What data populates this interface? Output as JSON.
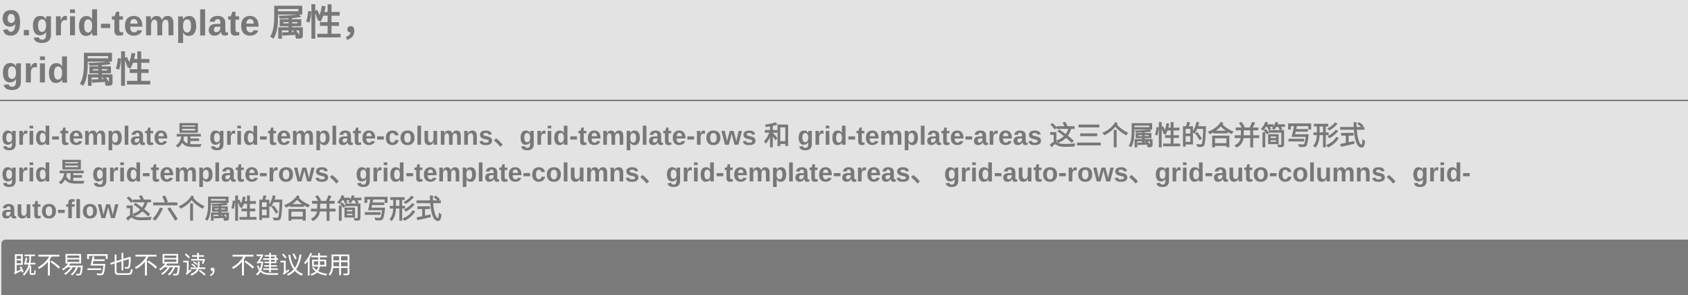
{
  "heading": {
    "lines": [
      "9.grid-template 属性，",
      "grid 属性"
    ]
  },
  "description": {
    "lines": [
      "grid-template 是 grid-template-columns、grid-template-rows 和 grid-template-areas 这三个属性的合并简写形式",
      "grid 是 grid-template-rows、grid-template-columns、grid-template-areas、 grid-auto-rows、grid-auto-columns、grid-",
      "auto-flow 这六个属性的合并简写形式"
    ]
  },
  "note": {
    "text": "既不易写也不易读，不建议使用"
  },
  "colors": {
    "background": "#e3e3e3",
    "text": "#787878",
    "note_bg": "#7a7a7a",
    "note_text": "#ffffff"
  }
}
